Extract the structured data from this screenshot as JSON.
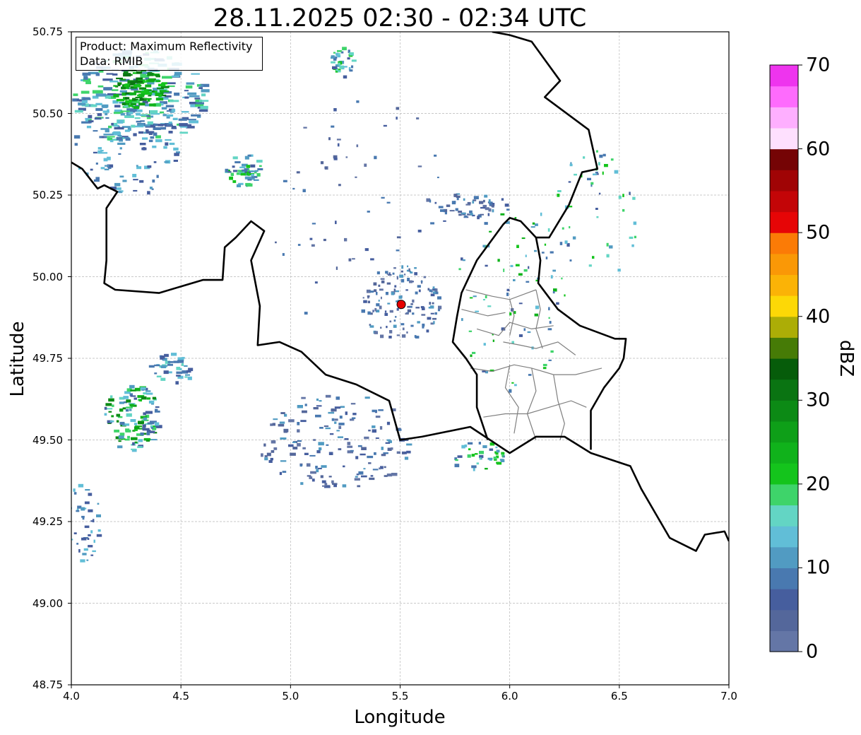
{
  "title": "28.11.2025 02:30 - 02:34 UTC",
  "xlabel": "Longitude",
  "ylabel": "Latitude",
  "info_box": {
    "line1": "Product: Maximum Reflectivity",
    "line2": "Data: RMIB"
  },
  "colorbar": {
    "label": "dBZ",
    "range": [
      0,
      70
    ],
    "step": 2.5,
    "tick_labels": [
      "0",
      "10",
      "20",
      "30",
      "40",
      "50",
      "60",
      "70"
    ],
    "tick_values": [
      0,
      10,
      20,
      30,
      40,
      50,
      60,
      70
    ],
    "colors": [
      "#6476a6",
      "#54679b",
      "#465e9e",
      "#4979b0",
      "#519bc2",
      "#61bed7",
      "#63d5c4",
      "#3ed46a",
      "#14c41c",
      "#10b21b",
      "#0e9f18",
      "#0c8a15",
      "#0a7412",
      "#065c0a",
      "#467b06",
      "#acad06",
      "#fdd806",
      "#fbb306",
      "#fa9806",
      "#fb7b06",
      "#e60506",
      "#c30507",
      "#a00405",
      "#750405",
      "#fee0fe",
      "#feafff",
      "#fe6bfd",
      "#ee34ee"
    ]
  },
  "chart_data": {
    "type": "map",
    "title": "28.11.2025 02:30 - 02:34 UTC",
    "xlabel": "Longitude",
    "ylabel": "Latitude",
    "xlim": [
      4.0,
      7.0
    ],
    "ylim": [
      48.75,
      50.75
    ],
    "x_ticks": [
      4.0,
      4.5,
      5.0,
      5.5,
      6.0,
      6.5,
      7.0
    ],
    "x_tick_labels": [
      "4.0",
      "4.5",
      "5.0",
      "5.5",
      "6.0",
      "6.5",
      "7.0"
    ],
    "y_ticks": [
      48.75,
      49.0,
      49.25,
      49.5,
      49.75,
      50.0,
      50.25,
      50.5,
      50.75
    ],
    "y_tick_labels": [
      "48.75",
      "49.00",
      "49.25",
      "49.50",
      "49.75",
      "50.00",
      "50.25",
      "50.50",
      "50.75"
    ],
    "grid": true,
    "radar_site": {
      "lon": 5.505,
      "lat": 49.915,
      "color": "#e60000"
    },
    "borders": {
      "belgium_france": [
        [
          4.0,
          50.35
        ],
        [
          4.05,
          50.33
        ],
        [
          4.12,
          50.27
        ],
        [
          4.15,
          50.28
        ],
        [
          4.21,
          50.26
        ],
        [
          4.16,
          50.21
        ],
        [
          4.16,
          50.05
        ],
        [
          4.15,
          49.98
        ],
        [
          4.2,
          49.96
        ],
        [
          4.4,
          49.95
        ],
        [
          4.6,
          49.99
        ],
        [
          4.69,
          49.99
        ],
        [
          4.7,
          50.09
        ],
        [
          4.75,
          50.12
        ],
        [
          4.82,
          50.17
        ],
        [
          4.88,
          50.14
        ],
        [
          4.82,
          50.05
        ],
        [
          4.86,
          49.91
        ],
        [
          4.85,
          49.79
        ],
        [
          4.95,
          49.8
        ],
        [
          5.05,
          49.77
        ],
        [
          5.16,
          49.7
        ],
        [
          5.3,
          49.67
        ],
        [
          5.45,
          49.62
        ],
        [
          5.5,
          49.5
        ],
        [
          5.6,
          49.51
        ],
        [
          5.82,
          49.54
        ],
        [
          6.0,
          49.46
        ],
        [
          6.12,
          49.51
        ],
        [
          6.25,
          49.51
        ],
        [
          6.37,
          49.46
        ],
        [
          6.55,
          49.42
        ],
        [
          6.6,
          49.35
        ],
        [
          6.73,
          49.2
        ],
        [
          6.85,
          49.16
        ],
        [
          6.89,
          49.21
        ],
        [
          6.98,
          49.22
        ],
        [
          7.0,
          49.19
        ]
      ],
      "belgium_germany": [
        [
          5.92,
          50.75
        ],
        [
          6.0,
          50.74
        ],
        [
          6.1,
          50.72
        ],
        [
          6.23,
          50.6
        ],
        [
          6.16,
          50.55
        ],
        [
          6.36,
          50.45
        ],
        [
          6.4,
          50.33
        ],
        [
          6.33,
          50.32
        ],
        [
          6.27,
          50.22
        ],
        [
          6.18,
          50.12
        ],
        [
          6.12,
          50.12
        ],
        [
          6.14,
          50.05
        ],
        [
          6.13,
          49.98
        ],
        [
          6.22,
          49.9
        ],
        [
          6.32,
          49.85
        ],
        [
          6.48,
          49.81
        ],
        [
          6.53,
          49.81
        ],
        [
          6.52,
          49.75
        ],
        [
          6.5,
          49.72
        ],
        [
          6.43,
          49.66
        ],
        [
          6.37,
          49.59
        ],
        [
          6.37,
          49.47
        ]
      ],
      "luxembourg_belgium": [
        [
          5.9,
          49.5
        ],
        [
          5.85,
          49.6
        ],
        [
          5.85,
          49.7
        ],
        [
          5.8,
          49.75
        ],
        [
          5.74,
          49.8
        ],
        [
          5.76,
          49.88
        ],
        [
          5.78,
          49.95
        ],
        [
          5.85,
          50.05
        ],
        [
          5.97,
          50.16
        ],
        [
          6.0,
          50.18
        ],
        [
          6.05,
          50.17
        ],
        [
          6.12,
          50.12
        ]
      ]
    },
    "luxembourg_cantons": true,
    "legend": "top-left"
  }
}
